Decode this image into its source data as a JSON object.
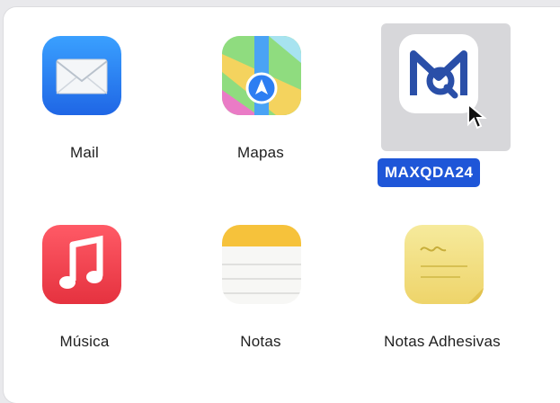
{
  "apps": [
    {
      "name": "Mail",
      "icon": "mail-icon",
      "color": "#2f7ff3"
    },
    {
      "name": "Mapas",
      "icon": "maps-icon",
      "color": "#6ccf63"
    },
    {
      "name": "MAXQDA24",
      "icon": "maxqda-icon",
      "color": "#2a4fa8",
      "selected": true
    },
    {
      "name": "Música",
      "icon": "music-icon",
      "color": "#f2414d"
    },
    {
      "name": "Notas",
      "icon": "notes-icon",
      "color": "#f6c23b"
    },
    {
      "name": "Notas Adhesivas",
      "icon": "stickies-icon",
      "color": "#f3e38a"
    }
  ],
  "colors": {
    "selection_bg": "#d7d7da",
    "selection_label": "#1e56d8"
  }
}
